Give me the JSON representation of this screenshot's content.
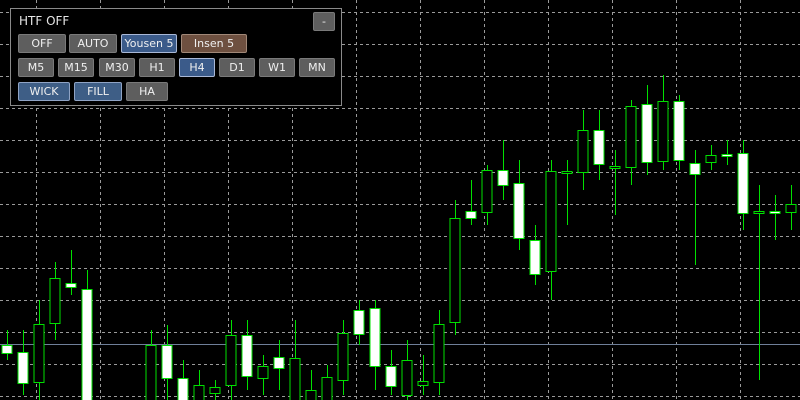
{
  "panel": {
    "title": "HTF  OFF",
    "minimize_label": "-",
    "row1": [
      "OFF",
      "AUTO",
      "Yousen 5",
      "Insen 5"
    ],
    "timeframes": [
      "M5",
      "M15",
      "M30",
      "H1",
      "H4",
      "D1",
      "W1",
      "MN"
    ],
    "selected_timeframe": "H4",
    "row3": [
      "WICK",
      "FILL",
      "HA"
    ]
  },
  "colors": {
    "background": "#000000",
    "grid": "#9a9a9a",
    "candle_outline": "#00e000",
    "bull_body": "#000000",
    "bear_body": "#ffffff",
    "price_line": "#6f7f99",
    "button_default": "#5e5e5e",
    "button_active": "#3b5b8a",
    "button_insen": "#6e5040"
  },
  "chart_data": {
    "type": "candlestick",
    "bull_fill": "black",
    "bear_fill": "white",
    "candles": [
      {
        "o": 3,
        "h": 4,
        "l": 2,
        "c": 0
      },
      {
        "o": 2,
        "h": 2,
        "l": -2,
        "c": -1
      },
      {
        "o": -1,
        "h": 3,
        "l": -1,
        "c": 2
      },
      {
        "o": 2,
        "h": 4,
        "l": 2,
        "c": 3
      },
      {
        "o": 3,
        "h": 5,
        "l": 0,
        "c": 0
      },
      {
        "o": 6,
        "h": 9,
        "l": 3,
        "c": 9
      },
      {
        "o": 7,
        "h": 8,
        "l": 7,
        "c": 8
      },
      {
        "o": 7,
        "h": 7,
        "l": -9,
        "c": -9
      }
    ]
  }
}
